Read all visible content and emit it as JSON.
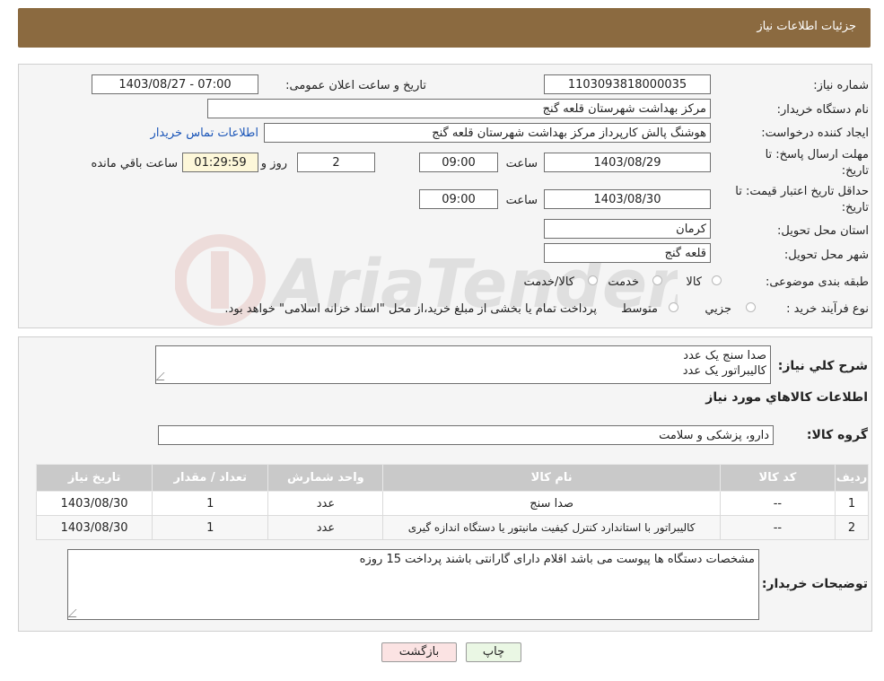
{
  "header": {
    "title": "جزئیات اطلاعات نیاز"
  },
  "form": {
    "need_number_label": "شماره نیاز:",
    "need_number": "1103093818000035",
    "announce_label": "تاریخ و ساعت اعلان عمومی:",
    "announce_value": "1403/08/27 - 07:00",
    "buyer_org_label": "نام دستگاه خریدار:",
    "buyer_org": "مرکز بهداشت شهرستان قلعه گنج",
    "creator_label": "ایجاد کننده درخواست:",
    "creator": "هوشنگ پالش کارپرداز مرکز بهداشت شهرستان قلعه گنج",
    "contact_link": "اطلاعات تماس خریدار",
    "deadline_label_1": "مهلت ارسال پاسخ: تا",
    "deadline_label_2": "تاریخ:",
    "deadline_date": "1403/08/29",
    "time_label": "ساعت",
    "deadline_time": "09:00",
    "days": "2",
    "days_label": "روز و",
    "remaining_time": "01:29:59",
    "remaining_label": "ساعت باقي مانده",
    "validity_label_1": "حداقل تاریخ اعتبار قیمت: تا",
    "validity_label_2": "تاریخ:",
    "validity_date": "1403/08/30",
    "validity_time": "09:00",
    "province_label": "استان محل تحویل:",
    "province": "کرمان",
    "city_label": "شهر محل تحویل:",
    "city": "قلعه گنج",
    "category_label": "طبقه بندی موضوعی:",
    "category_options": [
      "کالا",
      "خدمت",
      "کالا/خدمت"
    ],
    "process_label": "نوع فرآیند خرید :",
    "process_options": [
      "جزیي",
      "متوسط"
    ],
    "process_note": "پرداخت تمام یا بخشی از مبلغ خرید،از محل \"اسناد خزانه اسلامی\" خواهد بود."
  },
  "details": {
    "summary_label": "شرح کلي نياز:",
    "summary_lines": [
      "صدا سنج یک عدد",
      "کالیبراتور یک عدد"
    ],
    "goods_info_title": "اطلاعات کالاهاي مورد نياز",
    "goods_group_label": "گروه کالا:",
    "goods_group": "دارو، پزشکی و سلامت",
    "table": {
      "headers": [
        "رديف",
        "کد کالا",
        "نام کالا",
        "واحد شمارش",
        "تعداد / مقدار",
        "تاریخ نیاز"
      ],
      "rows": [
        [
          "1",
          "--",
          "صدا سنج",
          "عدد",
          "1",
          "1403/08/30"
        ],
        [
          "2",
          "--",
          "کالیبراتور با استاندارد کنترل کیفیت مانیتور یا دستگاه اندازه گیری",
          "عدد",
          "1",
          "1403/08/30"
        ]
      ]
    },
    "buyer_notes_label": "توضیحات خریدار:",
    "buyer_notes": "مشخصات دستگاه ها پیوست می باشد اقلام دارای گارانتی باشند پرداخت 15 روزه"
  },
  "buttons": {
    "print": "چاپ",
    "back": "بازگشت"
  },
  "watermark_text": "AriaTender.neT",
  "colors": {
    "header_bg": "#8b6a40",
    "print_bg": "#eaf7e4",
    "back_bg": "#fbe3e3",
    "link": "#1a55b8"
  }
}
